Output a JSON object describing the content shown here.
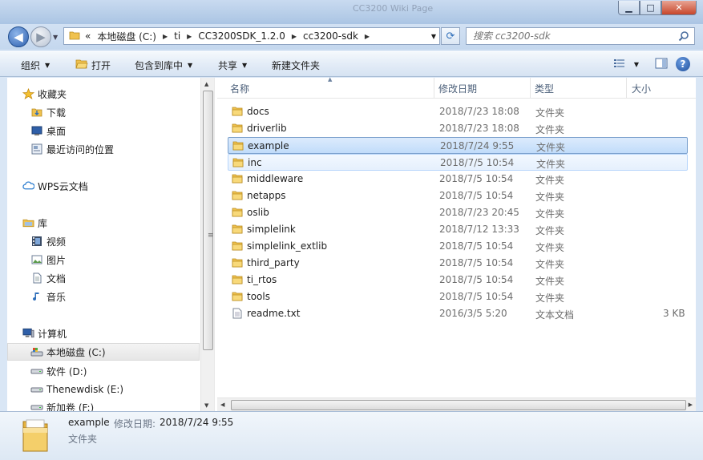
{
  "window": {
    "background_title": "CC3200 Wiki Page",
    "minimize": "▁",
    "maximize": "□",
    "close": "✕"
  },
  "nav": {
    "back": "◀",
    "forward": "▶",
    "breadcrumb": [
      "本地磁盘 (C:)",
      "ti",
      "CC3200SDK_1.2.0",
      "cc3200-sdk"
    ],
    "overflow": "«",
    "search_placeholder": "搜索 cc3200-sdk"
  },
  "toolbar": {
    "organize": "组织",
    "open": "打开",
    "include_in_library": "包含到库中",
    "share": "共享",
    "new_folder": "新建文件夹"
  },
  "navpane": {
    "favorites": "收藏夹",
    "downloads": "下载",
    "desktop": "桌面",
    "recent": "最近访问的位置",
    "wps": "WPS云文档",
    "libraries": "库",
    "videos": "视频",
    "pictures": "图片",
    "documents": "文档",
    "music": "音乐",
    "computer": "计算机",
    "drive_c": "本地磁盘 (C:)",
    "drive_d": "软件 (D:)",
    "drive_e": "Thenewdisk (E:)",
    "drive_f": "新加卷 (F:)"
  },
  "columns": {
    "name": "名称",
    "modified": "修改日期",
    "type": "类型",
    "size": "大小"
  },
  "files": [
    {
      "name": "docs",
      "date": "2018/7/23 18:08",
      "type": "文件夹",
      "size": ""
    },
    {
      "name": "driverlib",
      "date": "2018/7/23 18:08",
      "type": "文件夹",
      "size": ""
    },
    {
      "name": "example",
      "date": "2018/7/24 9:55",
      "type": "文件夹",
      "size": ""
    },
    {
      "name": "inc",
      "date": "2018/7/5 10:54",
      "type": "文件夹",
      "size": ""
    },
    {
      "name": "middleware",
      "date": "2018/7/5 10:54",
      "type": "文件夹",
      "size": ""
    },
    {
      "name": "netapps",
      "date": "2018/7/5 10:54",
      "type": "文件夹",
      "size": ""
    },
    {
      "name": "oslib",
      "date": "2018/7/23 20:45",
      "type": "文件夹",
      "size": ""
    },
    {
      "name": "simplelink",
      "date": "2018/7/12 13:33",
      "type": "文件夹",
      "size": ""
    },
    {
      "name": "simplelink_extlib",
      "date": "2018/7/5 10:54",
      "type": "文件夹",
      "size": ""
    },
    {
      "name": "third_party",
      "date": "2018/7/5 10:54",
      "type": "文件夹",
      "size": ""
    },
    {
      "name": "ti_rtos",
      "date": "2018/7/5 10:54",
      "type": "文件夹",
      "size": ""
    },
    {
      "name": "tools",
      "date": "2018/7/5 10:54",
      "type": "文件夹",
      "size": ""
    },
    {
      "name": "readme.txt",
      "date": "2016/3/5 5:20",
      "type": "文本文档",
      "size": "3 KB"
    }
  ],
  "details": {
    "name": "example",
    "modified_label": "修改日期:",
    "modified_value": "2018/7/24 9:55",
    "type": "文件夹"
  },
  "colors": {
    "selection_border": "#7da2ce",
    "folder": "#f0c24f",
    "chrome": "#c4d7ee"
  }
}
